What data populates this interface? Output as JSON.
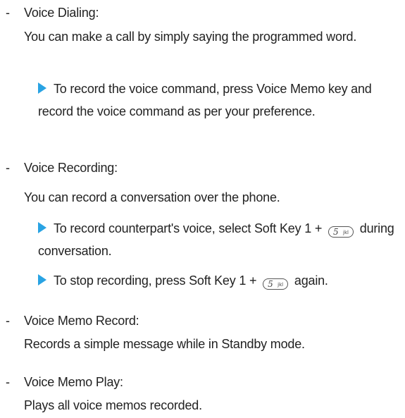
{
  "sections": [
    {
      "heading": "Voice Dialing:",
      "description": "You can make a call by simply saying the programmed word.",
      "steps": [
        "To record the voice command, press Voice Memo key and record the voice command as per your preference."
      ]
    },
    {
      "heading": "Voice Recording:",
      "description": "You can record a conversation over the phone.",
      "steps": [
        {
          "before": "To record counterpart's voice, select Soft Key 1 +",
          "after": "during conversation."
        },
        {
          "before": "To stop recording, press Soft Key 1 +",
          "after": "again."
        }
      ]
    },
    {
      "heading": "Voice Memo Record:",
      "description": "Records a simple message while in Standby mode."
    },
    {
      "heading": "Voice Memo Play:",
      "description": "Plays all voice memos recorded."
    }
  ],
  "dash": "-",
  "key_icon": {
    "name": "key-5-jkl-icon",
    "digit": "5",
    "letters": "jkl"
  },
  "bullet_color": "#29a3e3"
}
